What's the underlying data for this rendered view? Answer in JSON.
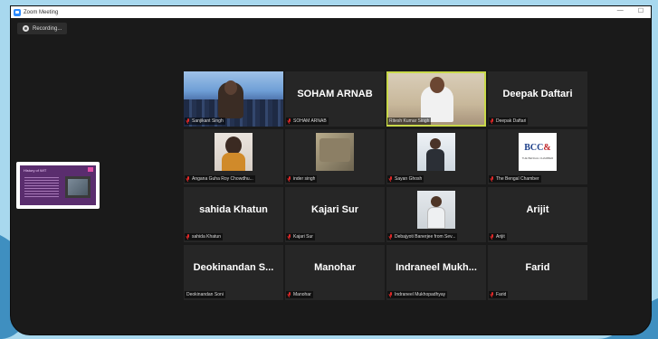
{
  "window": {
    "title": "Zoom Meeting",
    "minimize": "—",
    "restore": "☐"
  },
  "recording": {
    "label": "Recording..."
  },
  "shared_screen": {
    "title": "History of WIT"
  },
  "bcc": {
    "logo_left": "BCC",
    "logo_right": "&",
    "sub": "THE BENGAL CHAMBER"
  },
  "participants": [
    {
      "tile_name": "",
      "tag": "Sanjikant Singh"
    },
    {
      "tile_name": "SOHAM ARNAB",
      "tag": "SOHAM ARNAB"
    },
    {
      "tile_name": "",
      "tag": "Ritesh Kumar Singh",
      "active": true
    },
    {
      "tile_name": "Deepak Daftari",
      "tag": "Deepak Daftari"
    },
    {
      "tile_name": "",
      "tag": "Angana Guha Roy Chowdhu..."
    },
    {
      "tile_name": "",
      "tag": "inder singh"
    },
    {
      "tile_name": "",
      "tag": "Sayan Ghosh"
    },
    {
      "tile_name": "",
      "tag": "The Bengal Chamber"
    },
    {
      "tile_name": "sahida Khatun",
      "tag": "sahida Khatun"
    },
    {
      "tile_name": "Kajari Sur",
      "tag": "Kajari Sur"
    },
    {
      "tile_name": "",
      "tag": "Debajyoti Banerjee from Sev..."
    },
    {
      "tile_name": "Arijit",
      "tag": "Arijit"
    },
    {
      "tile_name": "Deokinandan S...",
      "tag": "Deokinandan Soni"
    },
    {
      "tile_name": "Manohar",
      "tag": "Manohar"
    },
    {
      "tile_name": "Indraneel Mukh...",
      "tag": "Indraneel Mukhopadhyay"
    },
    {
      "tile_name": "Farid",
      "tag": "Farid"
    }
  ]
}
